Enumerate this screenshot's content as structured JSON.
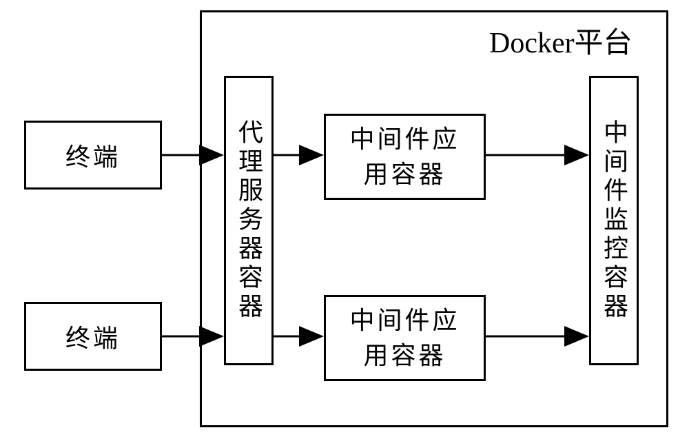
{
  "platform": {
    "title": "Docker平台"
  },
  "terminals": {
    "top": {
      "label": "终端"
    },
    "bottom": {
      "label": "终端"
    }
  },
  "proxy": {
    "label": "代理服务器容器"
  },
  "middleware": {
    "top": {
      "label_line1": "中间件应",
      "label_line2": "用容器"
    },
    "bottom": {
      "label_line1": "中间件应",
      "label_line2": "用容器"
    }
  },
  "monitor": {
    "label": "中间件监控容器"
  },
  "chart_data": {
    "type": "diagram",
    "title": "Docker平台",
    "nodes": [
      {
        "id": "terminal1",
        "label": "终端",
        "inside_platform": false
      },
      {
        "id": "terminal2",
        "label": "终端",
        "inside_platform": false
      },
      {
        "id": "proxy",
        "label": "代理服务器容器",
        "inside_platform": true
      },
      {
        "id": "middleware1",
        "label": "中间件应用容器",
        "inside_platform": true
      },
      {
        "id": "middleware2",
        "label": "中间件应用容器",
        "inside_platform": true
      },
      {
        "id": "monitor",
        "label": "中间件监控容器",
        "inside_platform": true
      }
    ],
    "edges": [
      {
        "from": "terminal1",
        "to": "proxy"
      },
      {
        "from": "terminal2",
        "to": "proxy"
      },
      {
        "from": "proxy",
        "to": "middleware1"
      },
      {
        "from": "proxy",
        "to": "middleware2"
      },
      {
        "from": "middleware1",
        "to": "monitor"
      },
      {
        "from": "middleware2",
        "to": "monitor"
      }
    ]
  }
}
